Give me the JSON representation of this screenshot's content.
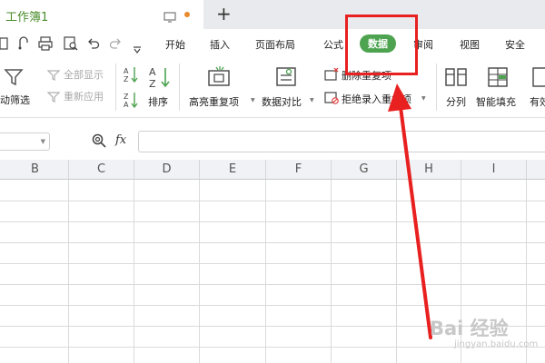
{
  "tab": {
    "title": "工作簿1"
  },
  "menu": {
    "items": [
      "开始",
      "插入",
      "页面布局",
      "公式",
      "数据",
      "审阅",
      "视图",
      "安全"
    ]
  },
  "ribbon": {
    "auto_filter": "动筛选",
    "show_all": "全部显示",
    "reapply": "重新应用",
    "sort": "排序",
    "highlight_dup": "高亮重复项",
    "compare": "数据对比",
    "delete_dup": "删除重复项",
    "reject_dup": "拒绝录入重复项",
    "split": "分列",
    "smart_fill": "智能填充",
    "valid_partial": "有效"
  },
  "formula_bar": {
    "fx": "fx"
  },
  "columns": [
    "B",
    "C",
    "D",
    "E",
    "F",
    "G",
    "H",
    "I"
  ],
  "colors": {
    "accent": "#4da34f",
    "highlight": "#e82020"
  },
  "watermark": {
    "text": "Bai 经验",
    "url": "jingyan.baidu.com"
  }
}
